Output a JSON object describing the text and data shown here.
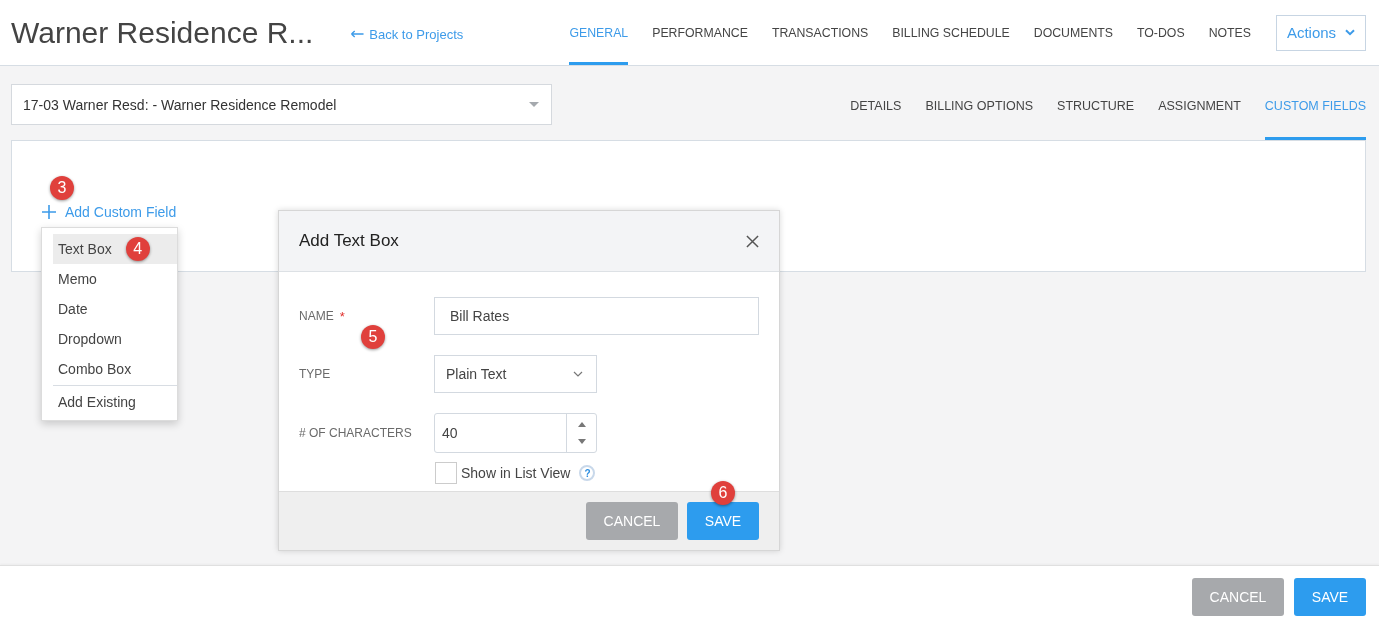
{
  "header": {
    "title": "Warner Residence R...",
    "back_link": "Back to Projects",
    "tabs": [
      {
        "label": "GENERAL",
        "selected": true
      },
      {
        "label": "PERFORMANCE",
        "selected": false
      },
      {
        "label": "TRANSACTIONS",
        "selected": false
      },
      {
        "label": "BILLING SCHEDULE",
        "selected": false
      },
      {
        "label": "DOCUMENTS",
        "selected": false
      },
      {
        "label": "TO-DOS",
        "selected": false
      },
      {
        "label": "NOTES",
        "selected": false
      }
    ],
    "actions_button": "Actions"
  },
  "project_select": {
    "value": "17-03 Warner Resd: - Warner Residence Remodel"
  },
  "subtabs": [
    {
      "label": "DETAILS",
      "selected": false
    },
    {
      "label": "BILLING OPTIONS",
      "selected": false
    },
    {
      "label": "STRUCTURE",
      "selected": false
    },
    {
      "label": "ASSIGNMENT",
      "selected": false
    },
    {
      "label": "CUSTOM FIELDS",
      "selected": true
    }
  ],
  "custom_fields": {
    "step_marker": "3",
    "add_link": "Add Custom Field",
    "menu": {
      "items": [
        {
          "label": "Text Box",
          "highlighted": true,
          "step_marker": "4"
        },
        {
          "label": "Memo",
          "highlighted": false
        },
        {
          "label": "Date",
          "highlighted": false
        },
        {
          "label": "Dropdown",
          "highlighted": false
        },
        {
          "label": "Combo Box",
          "highlighted": false
        }
      ],
      "footer_item": "Add Existing"
    }
  },
  "dialog": {
    "title": "Add Text Box",
    "step_marker": "5",
    "fields": [
      {
        "kind": "text",
        "label": "NAME",
        "required_mark": "*",
        "value": "Bill Rates"
      },
      {
        "kind": "select",
        "label": "TYPE",
        "value": "Plain Text"
      },
      {
        "kind": "number",
        "label": "# OF CHARACTERS",
        "value": "40"
      }
    ],
    "checkbox": {
      "label": "Show in List View",
      "checked": false,
      "help_icon": "?"
    },
    "buttons": [
      {
        "label": "CANCEL",
        "kind": "secondary"
      },
      {
        "label": "SAVE",
        "kind": "primary",
        "step_marker": "6"
      }
    ]
  },
  "footer": {
    "buttons": [
      {
        "label": "CANCEL",
        "kind": "secondary"
      },
      {
        "label": "SAVE",
        "kind": "primary"
      }
    ]
  }
}
